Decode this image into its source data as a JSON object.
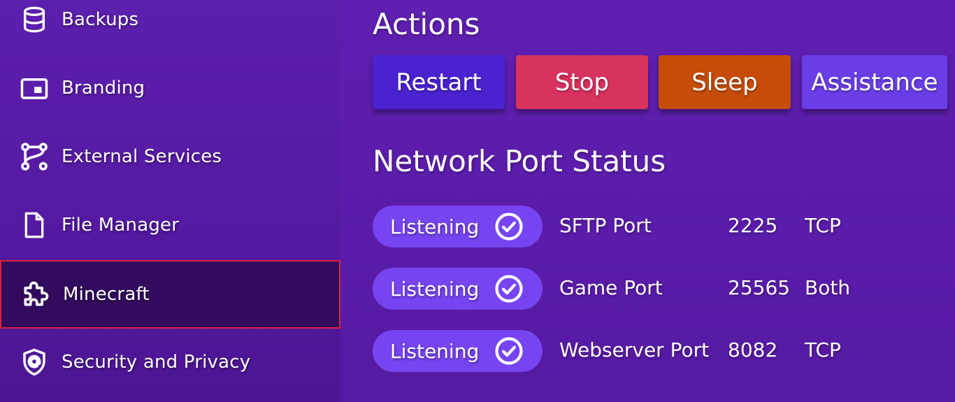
{
  "sidebar": {
    "items": [
      {
        "label": "Backups",
        "icon": "database-icon"
      },
      {
        "label": "Branding",
        "icon": "window-icon"
      },
      {
        "label": "External Services",
        "icon": "git-branch-icon"
      },
      {
        "label": "File Manager",
        "icon": "file-icon"
      },
      {
        "label": "Minecraft",
        "icon": "puzzle-icon",
        "active": true
      },
      {
        "label": "Security and Privacy",
        "icon": "shield-at-icon"
      }
    ]
  },
  "actions": {
    "title": "Actions",
    "buttons": [
      {
        "label": "Restart",
        "color": "#4a22d0"
      },
      {
        "label": "Stop",
        "color": "#d8325e"
      },
      {
        "label": "Sleep",
        "color": "#c64c07"
      },
      {
        "label": "Assistance",
        "color": "#6a3ee6"
      }
    ]
  },
  "ports": {
    "title": "Network Port Status",
    "rows": [
      {
        "status": "Listening",
        "name": "SFTP Port",
        "port": "2225",
        "protocol": "TCP"
      },
      {
        "status": "Listening",
        "name": "Game Port",
        "port": "25565",
        "protocol": "Both"
      },
      {
        "status": "Listening",
        "name": "Webserver Port",
        "port": "8082",
        "protocol": "TCP"
      }
    ]
  },
  "colors": {
    "background": "#5b1fa8",
    "active_nav": "#320b5e",
    "active_border": "#e0203a",
    "pill": "#7644f0"
  }
}
